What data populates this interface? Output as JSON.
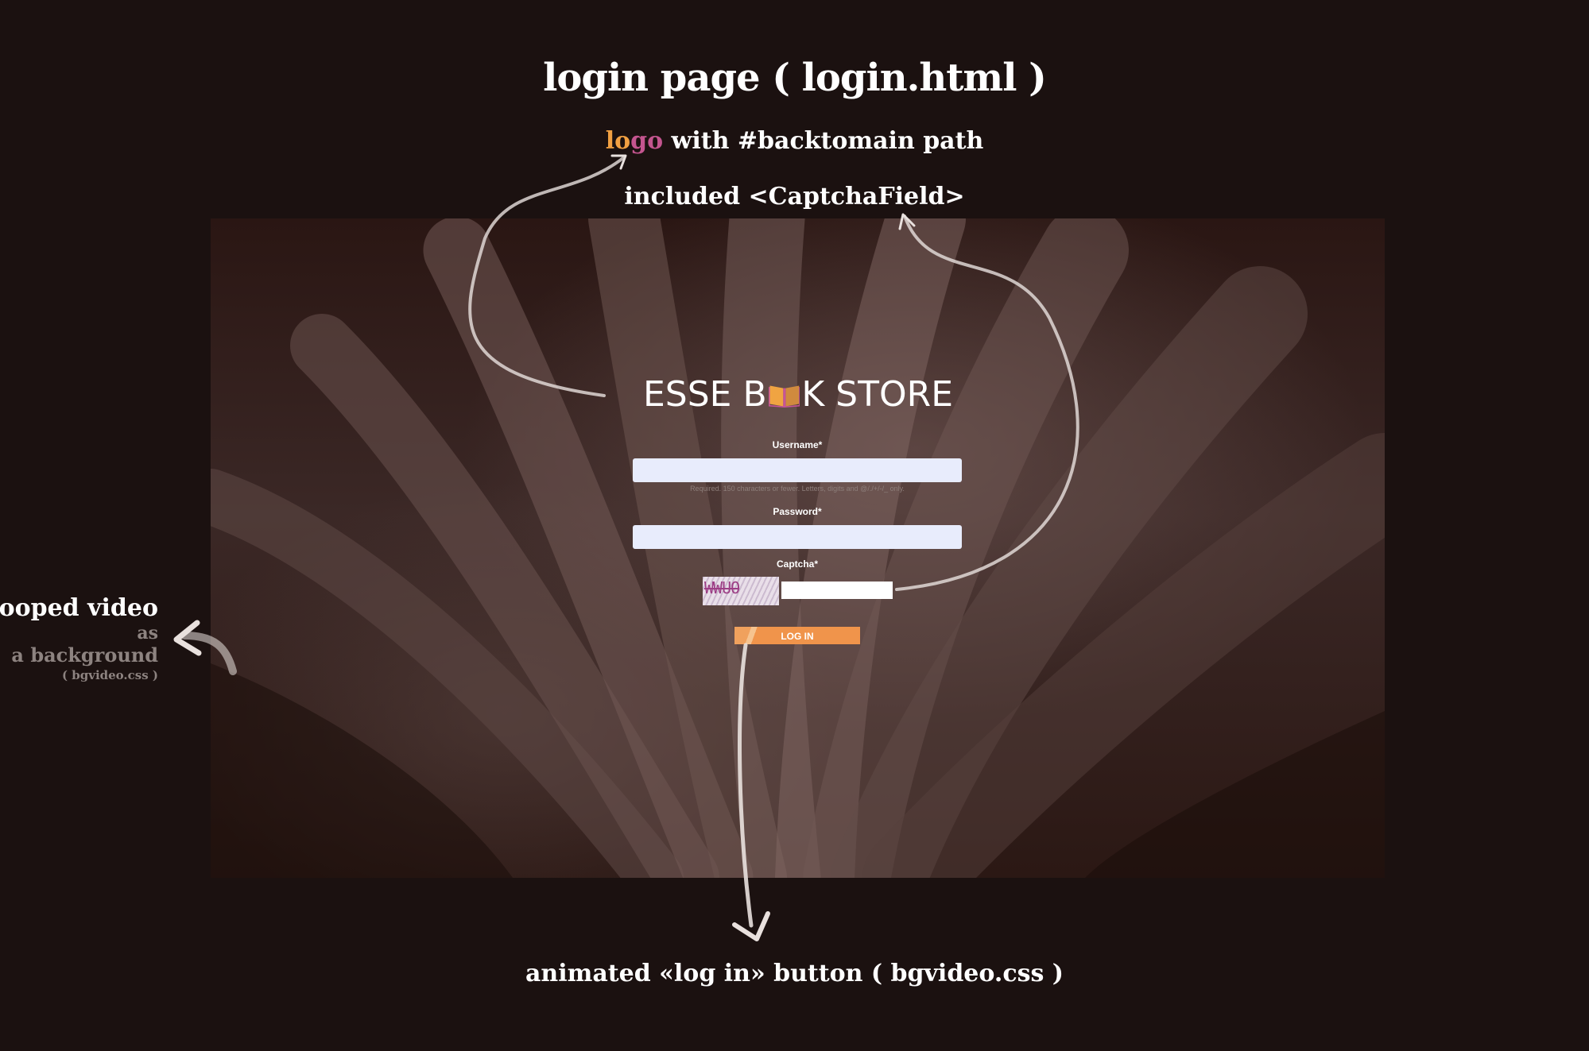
{
  "title": "login page ( login.html )",
  "notes": {
    "logo_lo": "lo",
    "logo_go": "go",
    "logo_rest": " with #backtomain path",
    "captcha": "included <CaptchaField>",
    "button": "animated «log in» button ( bgvideo.css )",
    "video": {
      "line1": "looped video",
      "line2": "as",
      "line3": "a background",
      "line4": "( bgvideo.css )"
    }
  },
  "logo": {
    "left": "ESSE B",
    "right": "K STORE",
    "icon": "open-book-icon",
    "colors": {
      "page_left": "#f0a442",
      "page_right": "#d08a3e",
      "cover": "#c8539a"
    }
  },
  "form": {
    "username_label": "Username*",
    "username_value": "",
    "username_help": "Required. 150 characters or fewer. Letters, digits and @/./+/-/_ only.",
    "password_label": "Password*",
    "password_value": "",
    "captcha_label": "Captcha*",
    "captcha_code": "WWUO",
    "captcha_value": "",
    "login_label": "LOG IN"
  },
  "colors": {
    "background": "#1b1110",
    "accent_orange": "#f1a042",
    "accent_pink": "#c4558f",
    "input_bg": "#e8ecfc"
  }
}
